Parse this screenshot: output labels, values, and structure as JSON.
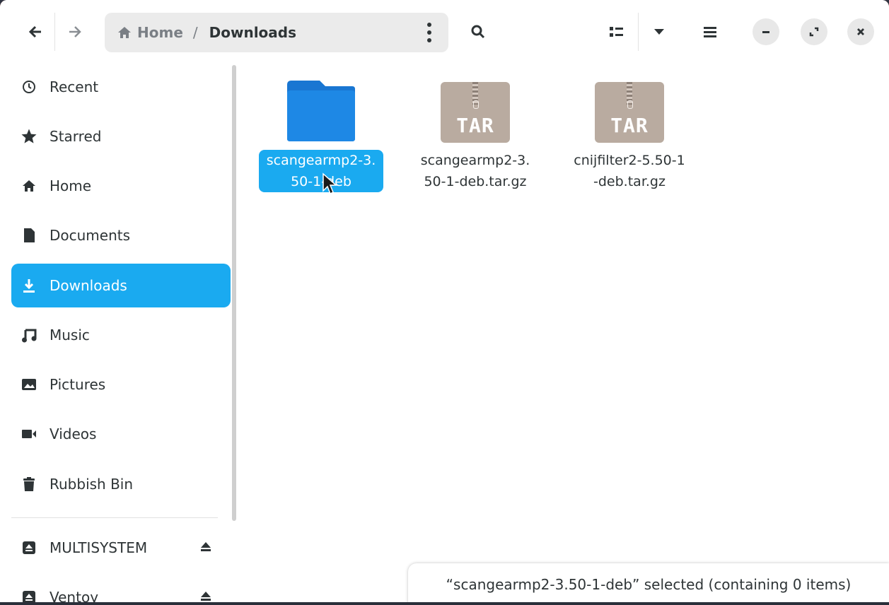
{
  "header": {
    "back_icon": "arrow-left-icon",
    "forward_icon": "arrow-right-icon",
    "path": {
      "home_label": "Home",
      "separator": "/",
      "current": "Downloads"
    },
    "search_icon": "search-icon",
    "view_icon": "grid-view-icon",
    "window_controls": [
      "minimize",
      "maximize",
      "close"
    ]
  },
  "sidebar": {
    "items": [
      {
        "label": "Recent",
        "icon": "clock-icon"
      },
      {
        "label": "Starred",
        "icon": "star-icon"
      },
      {
        "label": "Home",
        "icon": "home-icon"
      },
      {
        "label": "Documents",
        "icon": "document-icon"
      },
      {
        "label": "Downloads",
        "icon": "download-icon",
        "active": true
      },
      {
        "label": "Music",
        "icon": "music-icon"
      },
      {
        "label": "Pictures",
        "icon": "picture-icon"
      },
      {
        "label": "Videos",
        "icon": "video-icon"
      },
      {
        "label": "Rubbish Bin",
        "icon": "trash-icon"
      }
    ],
    "devices": [
      {
        "label": "MULTISYSTEM",
        "icon": "drive-icon"
      },
      {
        "label": "Ventoy",
        "icon": "drive-icon"
      }
    ]
  },
  "files": [
    {
      "name": "scangearmp2-3.50-1-deb",
      "type": "folder",
      "selected": true
    },
    {
      "name": "scangearmp2-3.50-1-deb.tar.gz",
      "type": "tar",
      "badge": "TAR"
    },
    {
      "name": "cnijfilter2-5.50-1-deb.tar.gz",
      "type": "tar",
      "badge": "TAR"
    }
  ],
  "status": {
    "text": "“scangearmp2-3.50-1-deb” selected  (containing 0 items)"
  },
  "colors": {
    "accent": "#1aaaf0",
    "folder": "#1e88e5",
    "tar": "#b9aba0"
  }
}
